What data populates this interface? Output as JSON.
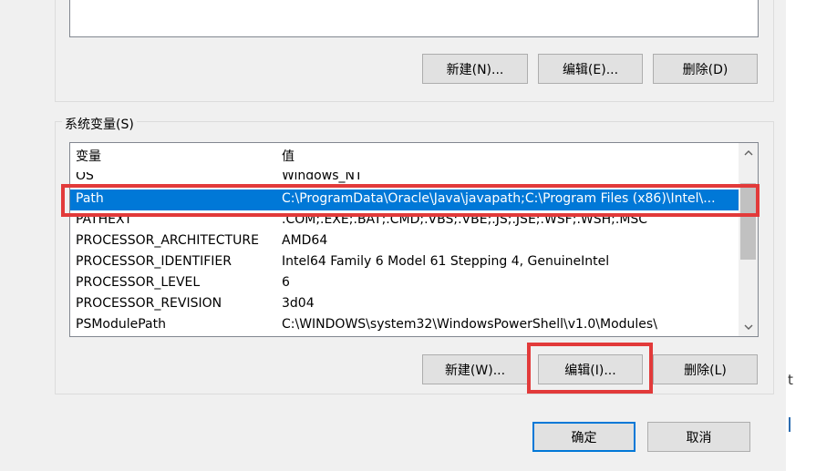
{
  "user_vars": {
    "buttons": {
      "new": "新建(N)...",
      "edit": "编辑(E)...",
      "delete": "删除(D)"
    }
  },
  "system_vars": {
    "group_label": "系统变量(S)",
    "columns": {
      "variable": "变量",
      "value": "值"
    },
    "rows": [
      {
        "name": "OS",
        "value": "Windows_NT"
      },
      {
        "name": "Path",
        "value": "C:\\ProgramData\\Oracle\\Java\\javapath;C:\\Program Files (x86)\\Intel\\...",
        "selected": true
      },
      {
        "name": "PATHEXT",
        "value": ".COM;.EXE;.BAT;.CMD;.VBS;.VBE;.JS;.JSE;.WSF;.WSH;.MSC"
      },
      {
        "name": "PROCESSOR_ARCHITECTURE",
        "value": "AMD64"
      },
      {
        "name": "PROCESSOR_IDENTIFIER",
        "value": "Intel64 Family 6 Model 61 Stepping 4, GenuineIntel"
      },
      {
        "name": "PROCESSOR_LEVEL",
        "value": "6"
      },
      {
        "name": "PROCESSOR_REVISION",
        "value": "3d04"
      },
      {
        "name": "PSModulePath",
        "value": "C:\\WINDOWS\\system32\\WindowsPowerShell\\v1.0\\Modules\\"
      }
    ],
    "buttons": {
      "new": "新建(W)...",
      "edit": "编辑(I)...",
      "delete": "删除(L)"
    }
  },
  "footer": {
    "ok": "确定",
    "cancel": "取消"
  },
  "background_glyphs": {
    "t": "t"
  },
  "colors": {
    "selection": "#0078d7",
    "highlight": "#e23a3a",
    "primary_border": "#0078d7"
  },
  "icons": {
    "scroll_up": "chevron-up-icon",
    "scroll_down": "chevron-down-icon"
  }
}
